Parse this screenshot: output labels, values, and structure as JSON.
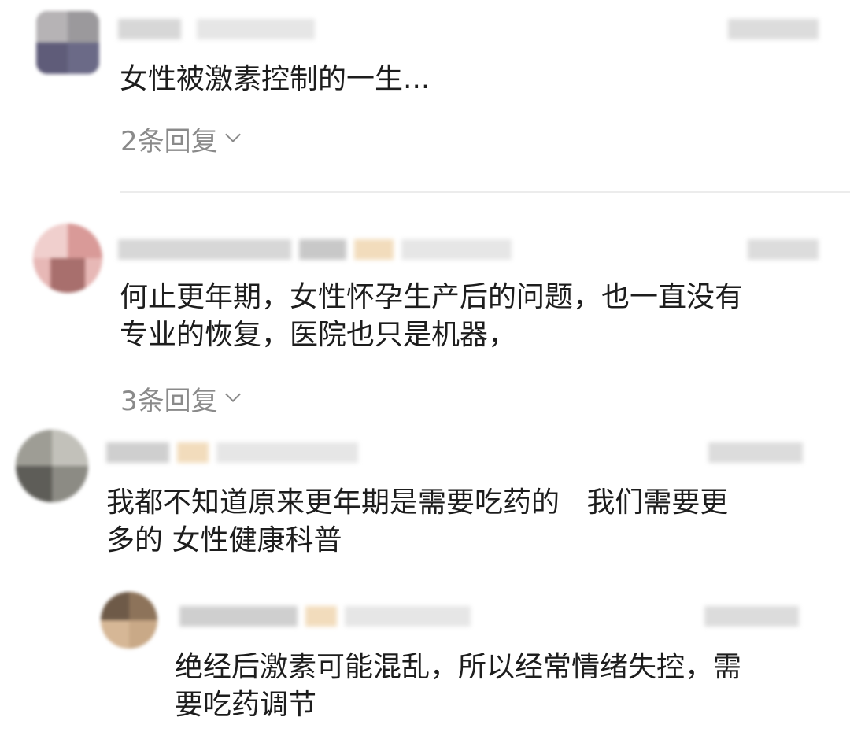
{
  "comments": [
    {
      "text": "女性被激素控制的一生...",
      "replies_label": "2条回复"
    },
    {
      "text": "何止更年期，女性怀孕生产后的问题，也一直没有\n专业的恢复，医院也只是机器，",
      "replies_label": "3条回复"
    },
    {
      "text": "我都不知道原来更年期是需要吃药的   我们需要更\n多的 女性健康科普"
    },
    {
      "text": "绝经后激素可能混乱，所以经常情绪失控，需\n要吃药调节"
    }
  ],
  "colors": {
    "text": "#1d1d1d",
    "secondary": "#8a8a8a",
    "divider": "#ececec",
    "blur_placeholder": "#d7d7d7"
  }
}
